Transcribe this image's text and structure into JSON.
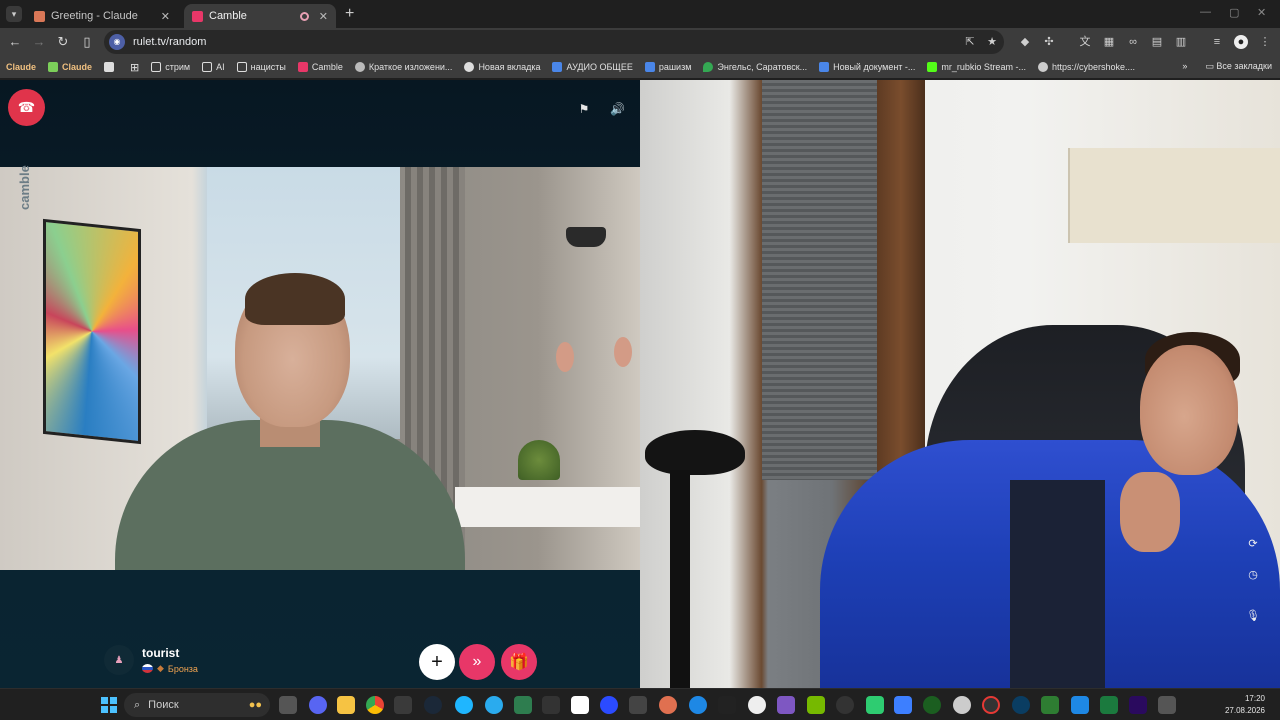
{
  "browser": {
    "tabs": [
      {
        "label": "Greeting - Claude",
        "favicon": "claude-icon",
        "active": false
      },
      {
        "label": "Camble",
        "favicon": "camble-icon",
        "active": true
      }
    ],
    "url": "rulet.tv/random",
    "bookmarks": [
      {
        "label": "Claude",
        "icon": "claude-wordmark"
      },
      {
        "label": "Claude",
        "icon": "claude-icon"
      },
      {
        "label": "",
        "icon": "bookmark-blank-icon"
      },
      {
        "label": "",
        "icon": "apps-grid-icon"
      },
      {
        "label": "стрим",
        "icon": "folder-icon"
      },
      {
        "label": "AI",
        "icon": "folder-icon"
      },
      {
        "label": "нацисты",
        "icon": "folder-icon"
      },
      {
        "label": "Camble",
        "icon": "camble-icon"
      },
      {
        "label": "Краткое изложени...",
        "icon": "globe-icon"
      },
      {
        "label": "Новая вкладка",
        "icon": "tab-icon"
      },
      {
        "label": "АУДИО ОБЩЕЕ",
        "icon": "docs-icon"
      },
      {
        "label": "рашизм",
        "icon": "docs-icon"
      },
      {
        "label": "Энгельс, Саратовск...",
        "icon": "maps-icon"
      },
      {
        "label": "Новый документ -...",
        "icon": "docs-icon"
      },
      {
        "label": "mr_rubkio Stream -...",
        "icon": "kick-icon"
      },
      {
        "label": "https://cybershoke....",
        "icon": "cybershoke-icon"
      }
    ],
    "all_bookmarks_label": "Все закладки"
  },
  "call": {
    "brand": "camble",
    "partner": {
      "username": "tourist",
      "rank": "Бронза",
      "country_flag": "russia-flag"
    },
    "buttons": {
      "add": "+",
      "next": "›",
      "gift": "gift-icon"
    }
  },
  "taskbar": {
    "search_placeholder": "Поиск",
    "time": "17:20",
    "date": "27.08.2026"
  },
  "colors": {
    "accent_pink": "#e83768",
    "end_call_red": "#e0344b",
    "rank_bronze": "#f1a451"
  }
}
